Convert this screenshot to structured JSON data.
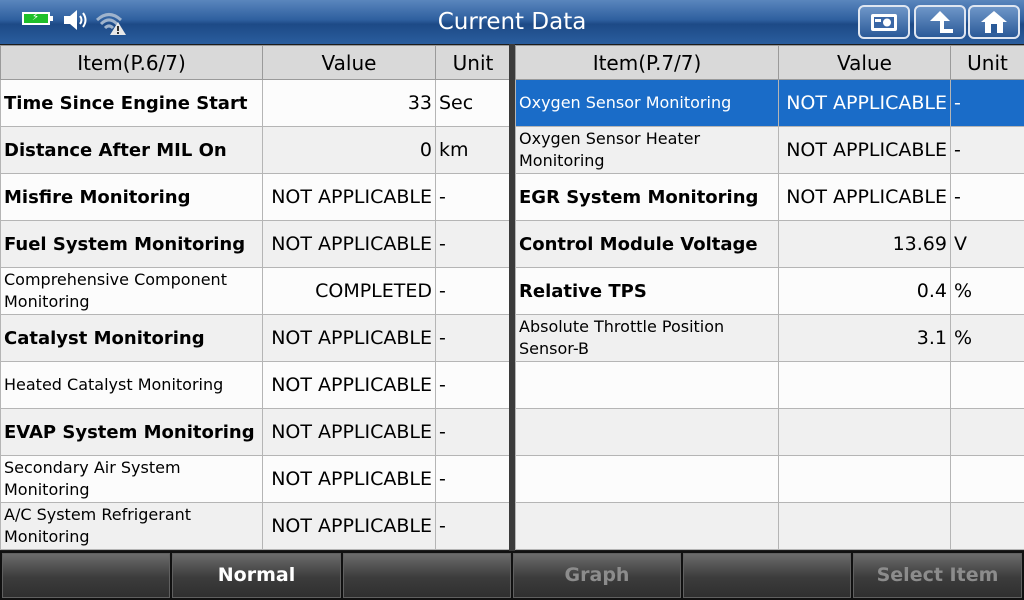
{
  "header": {
    "title": "Current Data"
  },
  "left_table": {
    "headers": {
      "item": "Item(P.6/7)",
      "value": "Value",
      "unit": "Unit"
    },
    "rows": [
      {
        "item": "Time Since Engine Start",
        "value": "33",
        "unit": "Sec"
      },
      {
        "item": "Distance After MIL On",
        "value": "0",
        "unit": "km"
      },
      {
        "item": "Misfire Monitoring",
        "value": "NOT APPLICABLE",
        "unit": "-"
      },
      {
        "item": "Fuel System Monitoring",
        "value": "NOT APPLICABLE",
        "unit": "-"
      },
      {
        "item": "Comprehensive Component Monitoring",
        "value": "COMPLETED",
        "unit": "-"
      },
      {
        "item": "Catalyst Monitoring",
        "value": "NOT APPLICABLE",
        "unit": "-"
      },
      {
        "item": "Heated Catalyst Monitoring",
        "value": "NOT APPLICABLE",
        "unit": "-"
      },
      {
        "item": "EVAP System Monitoring",
        "value": "NOT APPLICABLE",
        "unit": "-"
      },
      {
        "item": "Secondary Air System Monitoring",
        "value": "NOT APPLICABLE",
        "unit": "-"
      },
      {
        "item": "A/C System Refrigerant Monitoring",
        "value": "NOT APPLICABLE",
        "unit": "-"
      }
    ]
  },
  "right_table": {
    "headers": {
      "item": "Item(P.7/7)",
      "value": "Value",
      "unit": "Unit"
    },
    "rows": [
      {
        "item": "Oxygen Sensor Monitoring",
        "value": "NOT APPLICABLE",
        "unit": "-"
      },
      {
        "item": "Oxygen Sensor Heater Monitoring",
        "value": "NOT APPLICABLE",
        "unit": "-"
      },
      {
        "item": "EGR System Monitoring",
        "value": "NOT APPLICABLE",
        "unit": "-"
      },
      {
        "item": "Control Module Voltage",
        "value": "13.69",
        "unit": "V"
      },
      {
        "item": "Relative TPS",
        "value": "0.4",
        "unit": "%"
      },
      {
        "item": "Absolute Throttle Position Sensor-B",
        "value": "3.1",
        "unit": "%"
      },
      {
        "item": "",
        "value": "",
        "unit": ""
      },
      {
        "item": "",
        "value": "",
        "unit": ""
      },
      {
        "item": "",
        "value": "",
        "unit": ""
      },
      {
        "item": "",
        "value": "",
        "unit": ""
      }
    ]
  },
  "bottom_buttons": {
    "normal": "Normal",
    "graph": "Graph",
    "select_item": "Select Item"
  },
  "colors": {
    "title_bar": "#2e5f9f",
    "selected_row": "#1a6cc8",
    "battery": "#1fbf2a"
  }
}
